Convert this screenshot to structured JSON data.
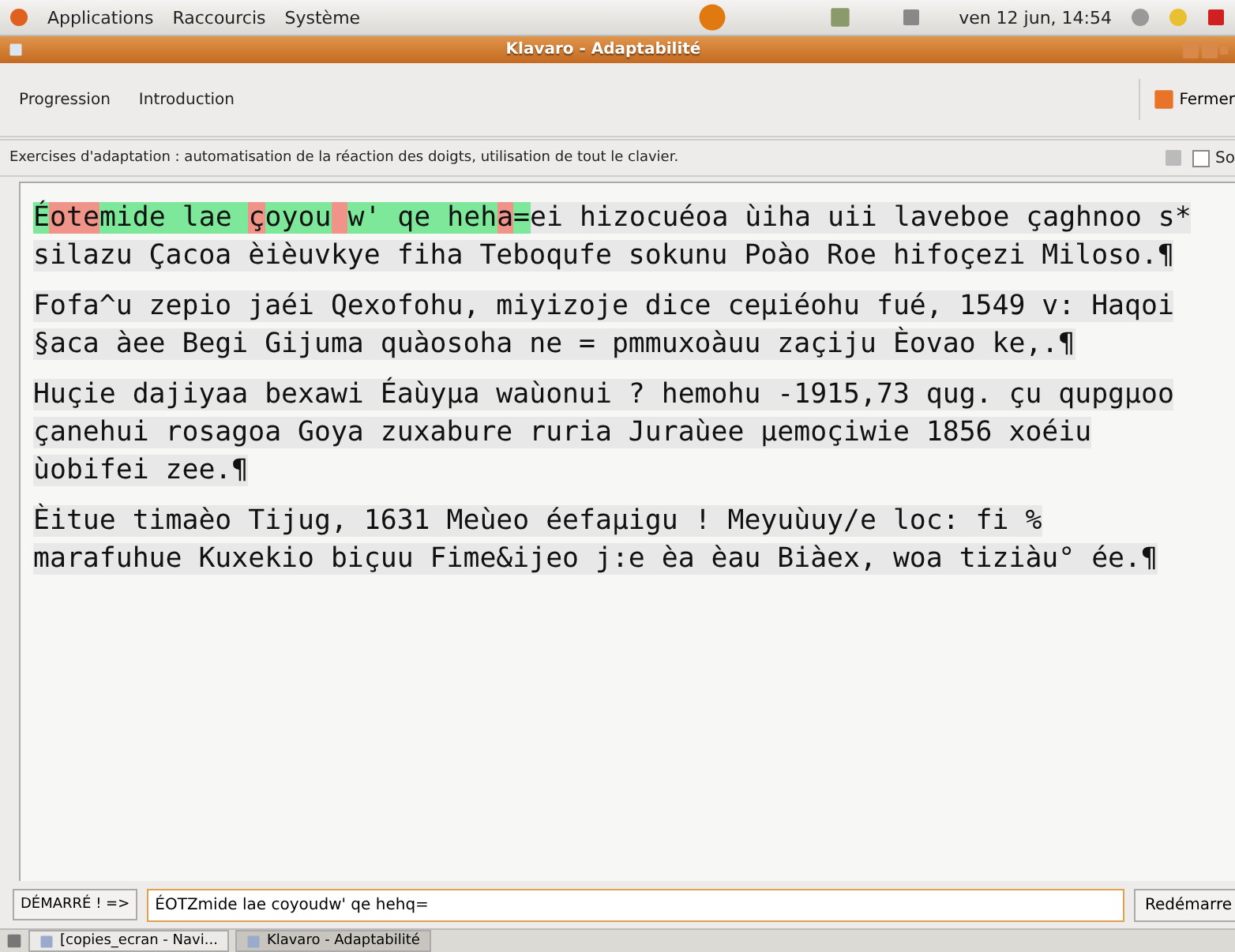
{
  "top_panel": {
    "menus": [
      "Applications",
      "Raccourcis",
      "Système"
    ],
    "clock": "ven 12 jun, 14:54"
  },
  "window": {
    "title": "Klavaro - Adaptabilité"
  },
  "toolbar": {
    "tabs": [
      "Progression",
      "Introduction"
    ],
    "close_label": "Fermer"
  },
  "instructions": "Exercises d'adaptation : automatisation de la réaction des doigts, utilisation de tout le clavier.",
  "option": {
    "label": "So",
    "checked": false
  },
  "paragraphs": [
    {
      "lines": [
        {
          "text": "Éotemide lae çoyou w' qe heha=ei hizocuéoa ùiha uii laveboe çaghnoo s*",
          "typed": [
            {
              "correct": true
            },
            {
              "correct": false
            },
            {
              "correct": false
            },
            {
              "correct": false
            },
            {
              "correct": true
            },
            {
              "correct": true
            },
            {
              "correct": true
            },
            {
              "correct": true
            },
            {
              "correct": true
            },
            {
              "correct": true
            },
            {
              "correct": true
            },
            {
              "correct": true
            },
            {
              "correct": true
            },
            {
              "correct": false
            },
            {
              "correct": true
            },
            {
              "correct": true
            },
            {
              "correct": true
            },
            {
              "correct": true
            },
            {
              "correct": false
            },
            {
              "correct": true
            },
            {
              "correct": true
            },
            {
              "correct": true
            },
            {
              "correct": true
            },
            {
              "correct": true
            },
            {
              "correct": true
            },
            {
              "correct": true
            },
            {
              "correct": true
            },
            {
              "correct": true
            },
            {
              "correct": false
            },
            {
              "correct": true
            }
          ]
        },
        {
          "text": "silazu Çacoa èièuvkye fiha Teboqufe sokunu Poào Roe hifoçezi Miloso.¶"
        }
      ]
    },
    {
      "lines": [
        {
          "text": "Fofa^u zepio jaéi Qexofohu, miyizoje dice ceμiéohu fué, 1549 v: Haqoi"
        },
        {
          "text": "§aca àee Begi Gijuma quàosoha ne = pmmuxoàuu zaçiju Èovao ke,.¶"
        }
      ]
    },
    {
      "lines": [
        {
          "text": "Huçie dajiyaa bexawi Éaùyμa waùonui ? hemohu -1915,73 qug. çu qupgμoo"
        },
        {
          "text": "çanehui rosagoa Goya zuxabure ruria Juraùee μemoçiwie 1856 xoéiu"
        },
        {
          "text": "ùobifei zee.¶"
        }
      ]
    },
    {
      "lines": [
        {
          "text": "Èitue timaèo Tijug, 1631 Meùeo éefaμigu ! Meyuùuy/e loc: fi %"
        },
        {
          "text": "marafuhue Kuxekio biçuu Fime&ijeo j:e èa èau Biàex, woa tiziàu° ée.¶"
        }
      ]
    }
  ],
  "status": "DÉMARRÉ ! =>",
  "input": {
    "value": "ÉOTZmide lae coyoudw' qe hehq="
  },
  "restart_label": "Redémarre",
  "taskbar": [
    {
      "label": "[copies_ecran - Navi...",
      "selected": false
    },
    {
      "label": "Klavaro - Adaptabilité",
      "selected": true
    }
  ]
}
